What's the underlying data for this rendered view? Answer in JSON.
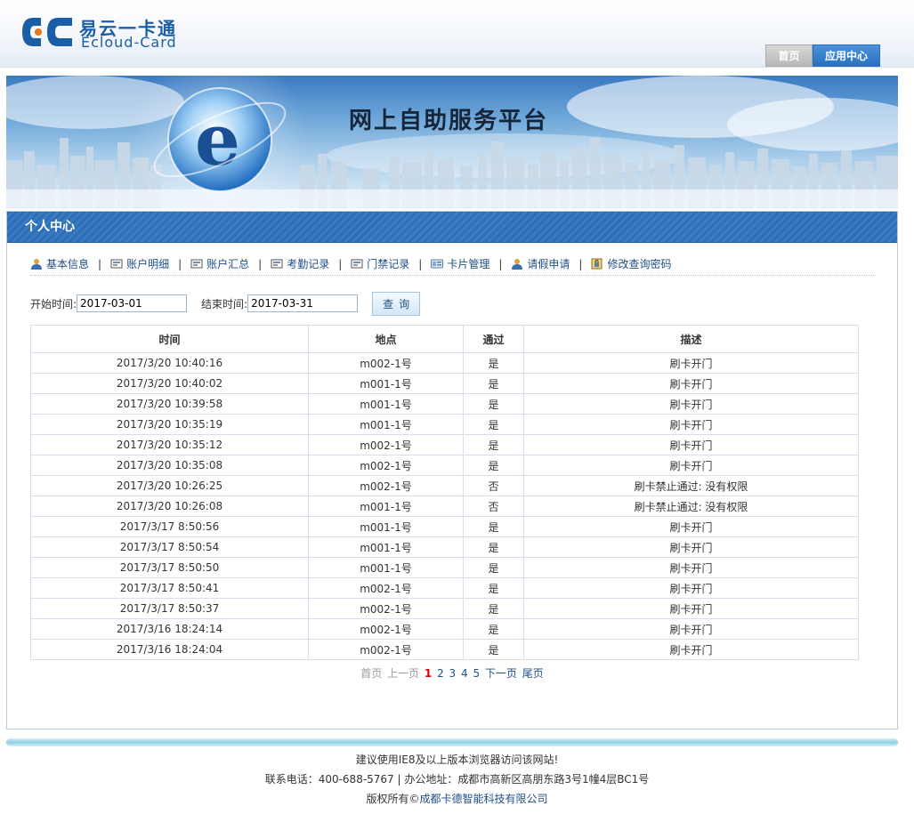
{
  "brand": {
    "cn_name": "易云一卡通",
    "en_name": "Ecloud-Card"
  },
  "topnav": {
    "home": "首页",
    "apps": "应用中心"
  },
  "banner": {
    "title": "网上自助服务平台"
  },
  "panel": {
    "title": "个人中心"
  },
  "subnav": [
    {
      "label": "基本信息",
      "icon": "user-icon"
    },
    {
      "label": "账户明细",
      "icon": "card-icon"
    },
    {
      "label": "账户汇总",
      "icon": "card-icon"
    },
    {
      "label": "考勤记录",
      "icon": "card-icon"
    },
    {
      "label": "门禁记录",
      "icon": "card-icon"
    },
    {
      "label": "卡片管理",
      "icon": "id-card-icon"
    },
    {
      "label": "请假申请",
      "icon": "user-icon"
    },
    {
      "label": "修改查询密码",
      "icon": "lock-icon"
    }
  ],
  "search": {
    "start_label": "开始时间:",
    "start_value": "2017-03-01",
    "end_label": "结束时间:",
    "end_value": "2017-03-31",
    "button": "查询"
  },
  "table": {
    "headers": [
      "时间",
      "地点",
      "通过",
      "描述"
    ],
    "rows": [
      [
        "2017/3/20 10:40:16",
        "m002-1号",
        "是",
        "刷卡开门"
      ],
      [
        "2017/3/20 10:40:02",
        "m001-1号",
        "是",
        "刷卡开门"
      ],
      [
        "2017/3/20 10:39:58",
        "m001-1号",
        "是",
        "刷卡开门"
      ],
      [
        "2017/3/20 10:35:19",
        "m001-1号",
        "是",
        "刷卡开门"
      ],
      [
        "2017/3/20 10:35:12",
        "m002-1号",
        "是",
        "刷卡开门"
      ],
      [
        "2017/3/20 10:35:08",
        "m002-1号",
        "是",
        "刷卡开门"
      ],
      [
        "2017/3/20 10:26:25",
        "m002-1号",
        "否",
        "刷卡禁止通过: 没有权限"
      ],
      [
        "2017/3/20 10:26:08",
        "m001-1号",
        "否",
        "刷卡禁止通过: 没有权限"
      ],
      [
        "2017/3/17 8:50:56",
        "m001-1号",
        "是",
        "刷卡开门"
      ],
      [
        "2017/3/17 8:50:54",
        "m001-1号",
        "是",
        "刷卡开门"
      ],
      [
        "2017/3/17 8:50:50",
        "m001-1号",
        "是",
        "刷卡开门"
      ],
      [
        "2017/3/17 8:50:41",
        "m002-1号",
        "是",
        "刷卡开门"
      ],
      [
        "2017/3/17 8:50:37",
        "m002-1号",
        "是",
        "刷卡开门"
      ],
      [
        "2017/3/16 18:24:14",
        "m002-1号",
        "是",
        "刷卡开门"
      ],
      [
        "2017/3/16 18:24:04",
        "m002-1号",
        "是",
        "刷卡开门"
      ]
    ]
  },
  "pager": {
    "first": "首页",
    "prev": "上一页",
    "pages": [
      "1",
      "2",
      "3",
      "4",
      "5"
    ],
    "current": "1",
    "next": "下一页",
    "last": "尾页"
  },
  "footer": {
    "line1": "建议使用IE8及以上版本浏览器访问该网站!",
    "line2": "联系电话：400-688-5767 | 办公地址：成都市高新区高朋东路3号1幢4层BC1号",
    "line3_prefix": "版权所有©",
    "line3_link": "成都卡德智能科技有限公司"
  },
  "colors": {
    "accent": "#2f6fb6",
    "link": "#1d4f86",
    "pager_current": "#dd0000"
  }
}
